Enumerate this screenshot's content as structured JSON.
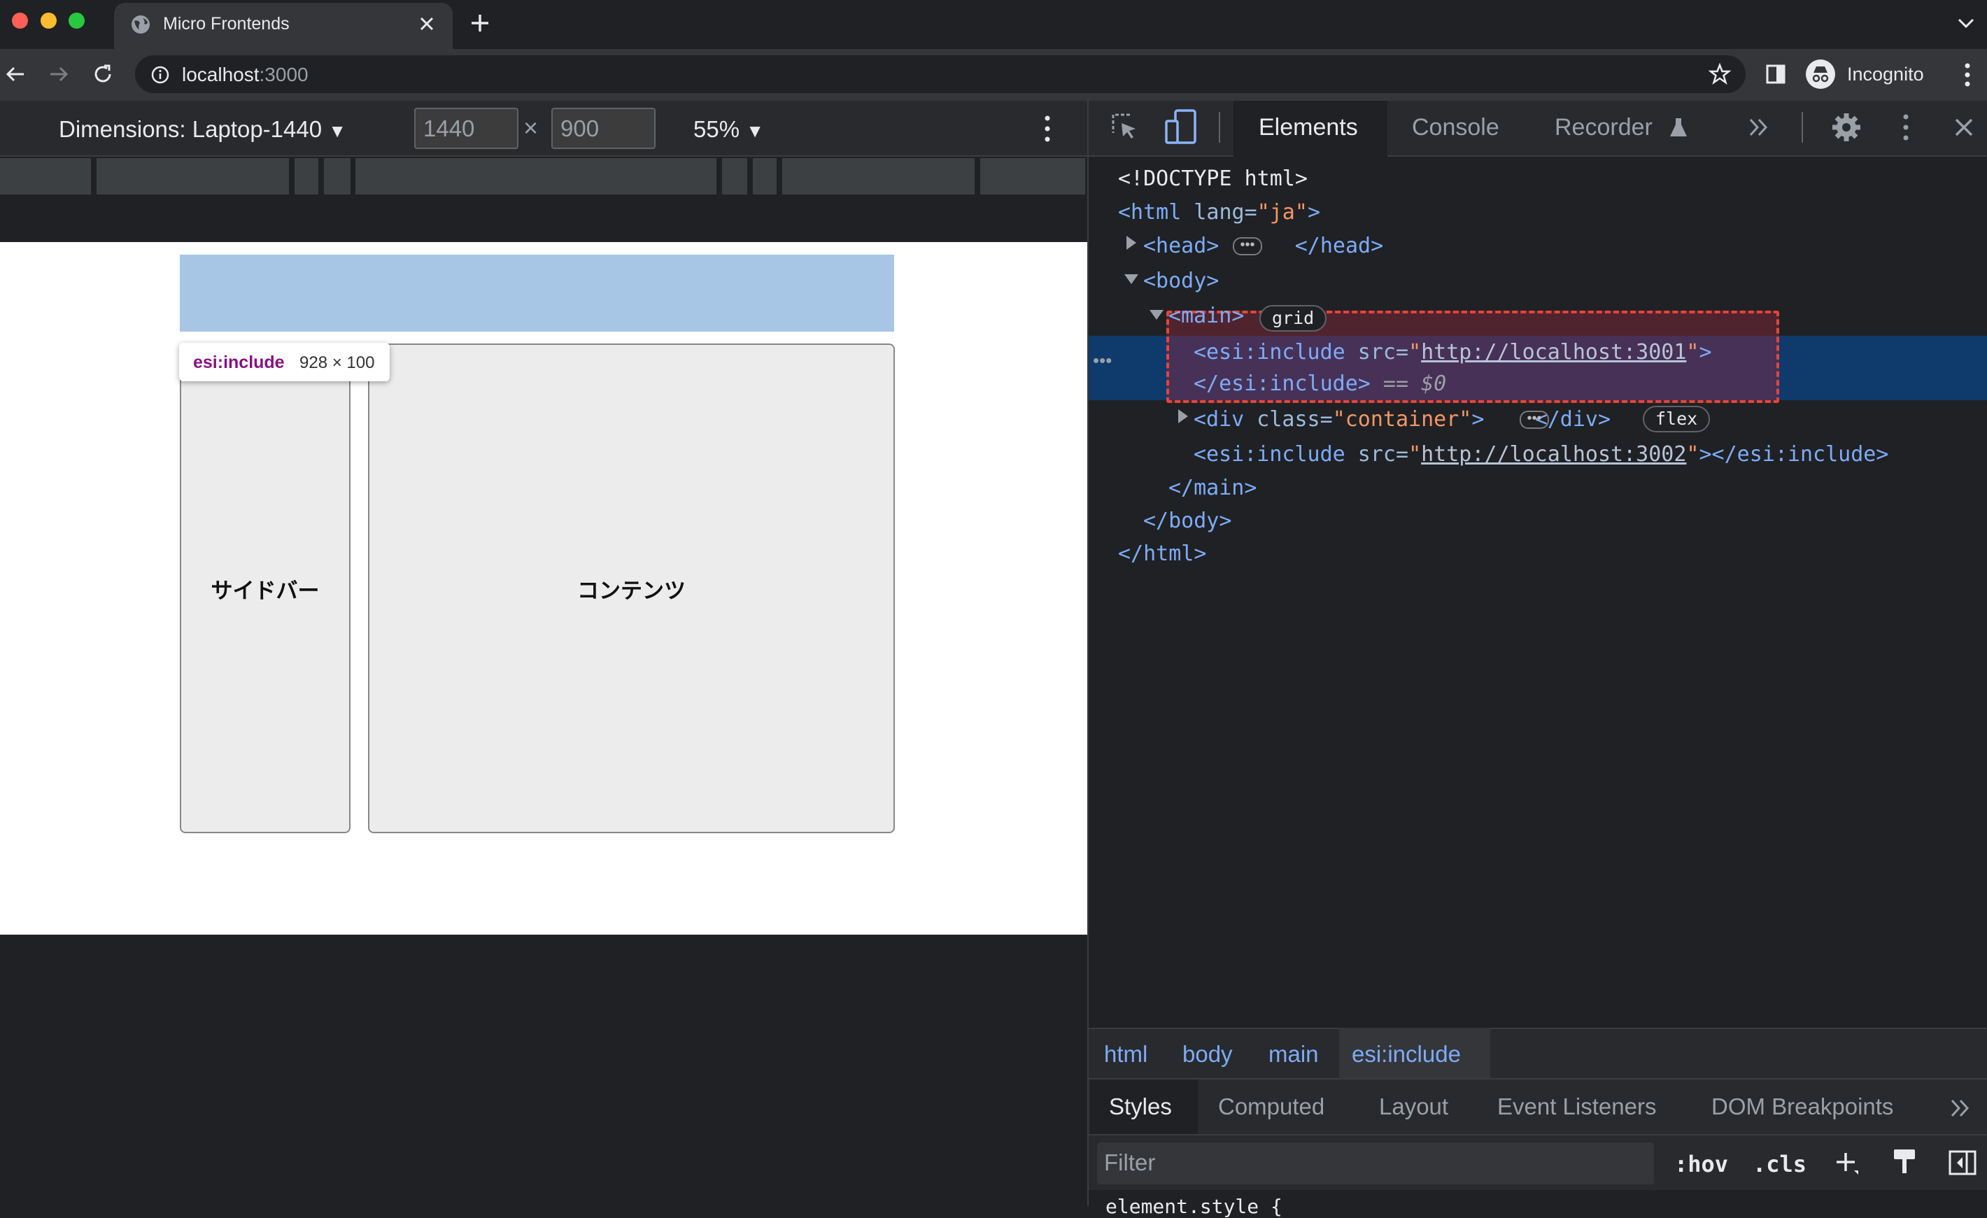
{
  "browser": {
    "tab_title": "Micro Frontends",
    "url_host": "localhost",
    "url_port": ":3000",
    "incognito_label": "Incognito"
  },
  "device_toolbar": {
    "dimensions_label": "Dimensions: Laptop-1440",
    "width": "1440",
    "height": "900",
    "times": "×",
    "zoom": "55%"
  },
  "page": {
    "sidebar_label": "サイドバー",
    "content_label": "コンテンツ",
    "tooltip_tag": "esi:include",
    "tooltip_size": "928 × 100"
  },
  "devtools": {
    "tabs": [
      "Elements",
      "Console",
      "Recorder"
    ],
    "dom": {
      "doctype": "<!DOCTYPE html>",
      "html_open_tag": "<html",
      "html_lang_attr": " lang=",
      "html_lang_val": "\"ja\"",
      "head_open": "<head>",
      "head_close": "</head>",
      "body_open": "<body>",
      "main_open": "<main>",
      "grid_badge": "grid",
      "esi1_open": "<esi:include",
      "esi_src_attr": " src=",
      "esi1_src": "http://localhost:3001",
      "esi1_close": "</esi:include>",
      "selected_marker": " == $0",
      "div_open": "<div",
      "div_class_attr": " class=",
      "div_class_val": "\"container\"",
      "div_close": "</div>",
      "flex_badge": "flex",
      "esi2_src": "http://localhost:3002",
      "esi2_close": "></esi:include>",
      "main_close": "</main>",
      "body_close": "</body>",
      "html_close": "</html>"
    },
    "breadcrumbs": [
      "html",
      "body",
      "main",
      "esi:include"
    ],
    "subtabs": [
      "Styles",
      "Computed",
      "Layout",
      "Event Listeners",
      "DOM Breakpoints"
    ],
    "filter_placeholder": "Filter",
    "hov": ":hov",
    "cls": ".cls",
    "element_style": "element.style {"
  },
  "colors": {
    "header_include": "#a7c6e6",
    "selection": "#0f3a6c",
    "overlay_border": "#e2463a"
  }
}
